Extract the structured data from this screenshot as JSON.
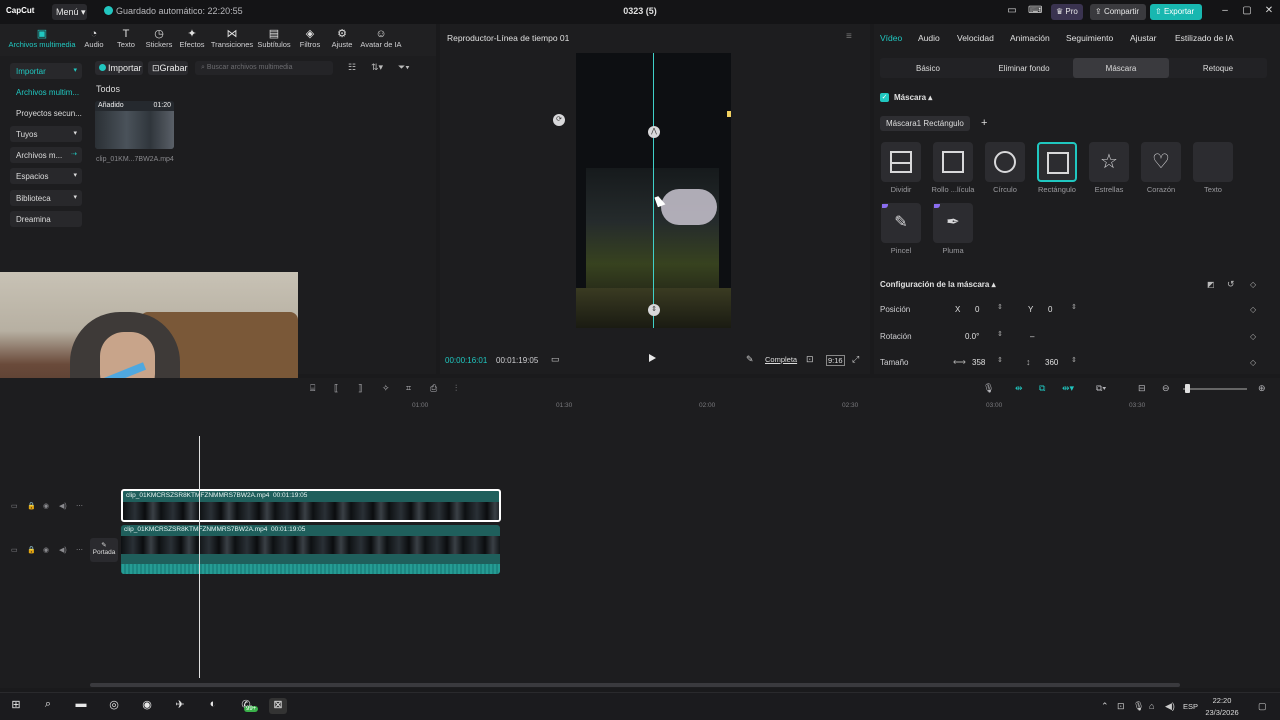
{
  "titlebar": {
    "app_name": "CapCut",
    "menu_label": "Menú",
    "autosave": "Guardado automático: 22:20:55",
    "project_title": "0323 (5)",
    "pro_label": "Pro",
    "share_label": "Compartir",
    "export_label": "Exportar"
  },
  "toolbar": {
    "items": [
      {
        "label": "Archivos multimedia",
        "icon": "media-icon"
      },
      {
        "label": "Audio",
        "icon": "audio-icon"
      },
      {
        "label": "Texto",
        "icon": "text-icon"
      },
      {
        "label": "Stickers",
        "icon": "sticker-icon"
      },
      {
        "label": "Efectos",
        "icon": "effects-icon"
      },
      {
        "label": "Transiciones",
        "icon": "transitions-icon"
      },
      {
        "label": "Subtítulos",
        "icon": "subtitles-icon"
      },
      {
        "label": "Filtros",
        "icon": "filters-icon"
      },
      {
        "label": "Ajuste",
        "icon": "adjust-icon"
      },
      {
        "label": "Avatar de IA",
        "icon": "ai-avatar-icon"
      }
    ]
  },
  "sidebar": {
    "items": [
      {
        "label": "Importar"
      },
      {
        "label": "Archivos multim..."
      },
      {
        "label": "Proyectos secun..."
      },
      {
        "label": "Tuyos"
      },
      {
        "label": "Archivos m..."
      },
      {
        "label": "Espacios"
      },
      {
        "label": "Biblioteca"
      },
      {
        "label": "Dreamina"
      }
    ]
  },
  "media": {
    "import_label": "Importar",
    "record_label": "Grabar",
    "search_placeholder": "Buscar archivos multimedia",
    "filter_all": "Todos",
    "thumb_added": "Añadido",
    "thumb_duration": "01:20",
    "thumb_name": "clip_01KM...7BW2A.mp4"
  },
  "player": {
    "title": "Reproductor-Línea de tiempo 01",
    "time_current": "00:00:16:01",
    "time_total": "00:01:19:05",
    "full_label": "Completa",
    "ratio_label": "9:16"
  },
  "props": {
    "tabs": [
      "Vídeo",
      "Audio",
      "Velocidad",
      "Animación",
      "Seguimiento",
      "Ajustar",
      "Estilizado de IA"
    ],
    "subtabs": [
      "Básico",
      "Eliminar fondo",
      "Máscara",
      "Retoque"
    ],
    "mask_label": "Máscara",
    "mask_pill": "Máscara1 Rectángulo",
    "mask_types": [
      {
        "label": "Dividir",
        "icon": "split-mask-icon"
      },
      {
        "label": "Rollo ...lícula",
        "icon": "film-mask-icon"
      },
      {
        "label": "Círculo",
        "icon": "circle-mask-icon"
      },
      {
        "label": "Rectángulo",
        "icon": "rectangle-mask-icon"
      },
      {
        "label": "Estrellas",
        "icon": "star-mask-icon"
      },
      {
        "label": "Corazón",
        "icon": "heart-mask-icon"
      },
      {
        "label": "Texto",
        "icon": "text-mask-icon"
      },
      {
        "label": "Pincel",
        "icon": "brush-mask-icon"
      },
      {
        "label": "Pluma",
        "icon": "pen-mask-icon"
      }
    ],
    "config_label": "Configuración de la máscara",
    "position_label": "Posición",
    "pos_x_label": "X",
    "pos_x": "0",
    "pos_y_label": "Y",
    "pos_y": "0",
    "rotation_label": "Rotación",
    "rotation": "0.0°",
    "rotation_extra": "–",
    "size_label": "Tamaño",
    "size_w": "358",
    "size_h": "360"
  },
  "timeline": {
    "ruler_ticks": [
      "01:00",
      "01:30",
      "02:00",
      "02:30",
      "03:00",
      "03:30"
    ],
    "clip1_name": "clip_01KMCRSZSR8KTMFZNMMRS7BW2A.mp4",
    "clip1_duration": "00:01:19:05",
    "clip2_name": "clip_01KMCRSZSR8KTMFZNMMRS7BW2A.mp4",
    "clip2_duration": "00:01:19:05",
    "cover_label": "Portada"
  },
  "taskbar": {
    "lang": "ESP",
    "time": "22:20",
    "date": "23/3/2026",
    "badge": "99+"
  },
  "colors": {
    "accent": "#20c7c0",
    "panel": "#1d1d1f",
    "clip": "#1f5f5c"
  }
}
